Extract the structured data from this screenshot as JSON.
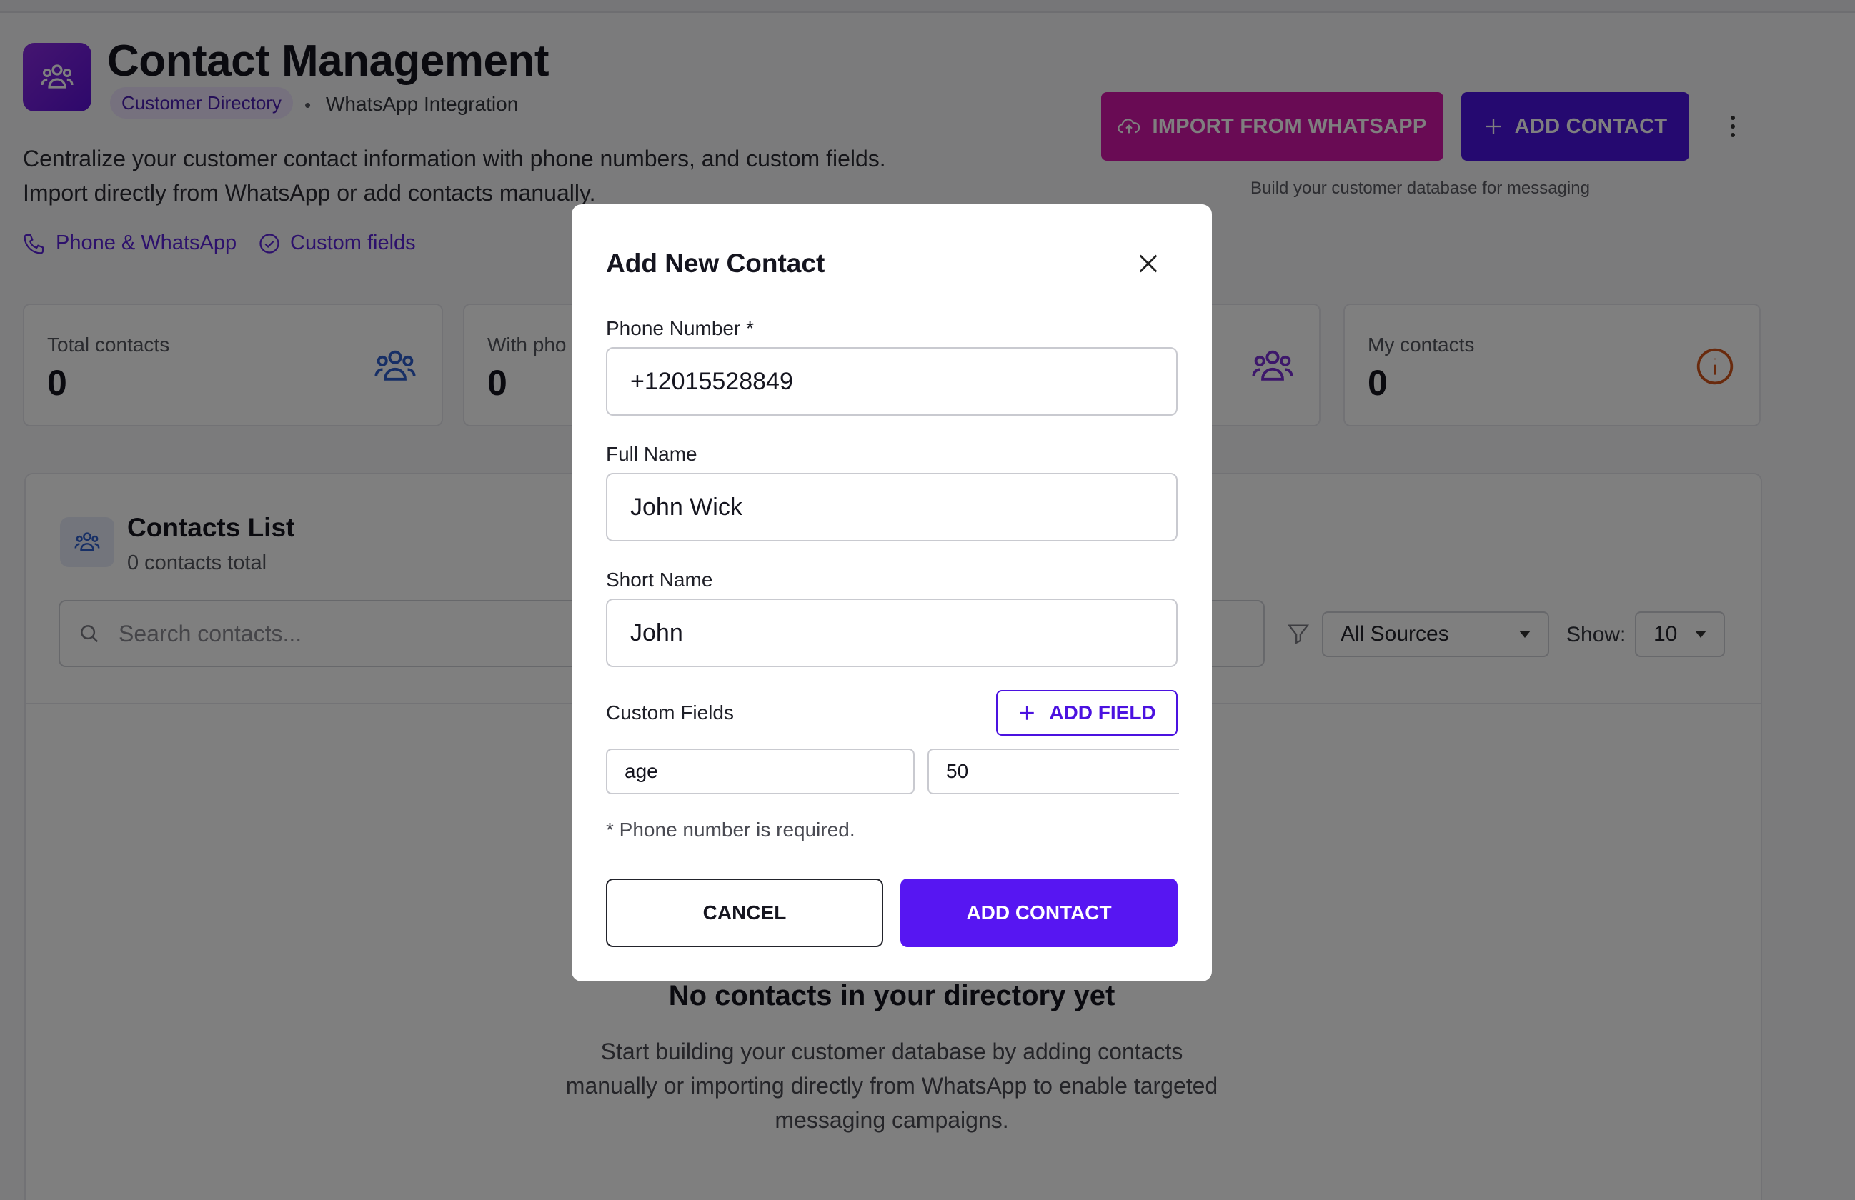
{
  "header": {
    "title": "Contact Management",
    "chip": "Customer Directory",
    "separator": "•",
    "subtitle": "WhatsApp Integration",
    "description_line1": "Centralize your customer contact information with phone numbers, and custom fields.",
    "description_line2": "Import directly from WhatsApp or add contacts manually.",
    "features": [
      "Phone & WhatsApp",
      "Custom fields"
    ],
    "import_button": "IMPORT FROM WHATSAPP",
    "add_button": "ADD CONTACT",
    "helper_text": "Build your customer database for messaging"
  },
  "stats": [
    {
      "label": "Total contacts",
      "value": "0"
    },
    {
      "label": "With pho",
      "value": "0"
    },
    {
      "label": "",
      "value": ""
    },
    {
      "label": "My contacts",
      "value": "0"
    }
  ],
  "list": {
    "title": "Contacts List",
    "subtitle": "0 contacts total",
    "search_placeholder": "Search contacts...",
    "source_filter": "All Sources",
    "show_label": "Show:",
    "page_size": "10",
    "empty_title": "No contacts in your directory yet",
    "empty_description": "Start building your customer database by adding contacts manually or importing directly from WhatsApp to enable targeted messaging campaigns."
  },
  "modal": {
    "title": "Add New Contact",
    "phone_label": "Phone Number *",
    "phone_value": "+12015528849",
    "full_name_label": "Full Name",
    "full_name_value": "John Wick",
    "short_name_label": "Short Name",
    "short_name_value": "John",
    "custom_fields_label": "Custom Fields",
    "add_field_button": "ADD FIELD",
    "custom_field_key": "age",
    "custom_field_value": "50",
    "required_note": "* Phone number is required.",
    "cancel_button": "CANCEL",
    "submit_button": "ADD CONTACT"
  },
  "colors": {
    "accent": "#4b12e0",
    "import": "#d316a8",
    "submit": "#5716f2",
    "info": "#d2541a"
  }
}
